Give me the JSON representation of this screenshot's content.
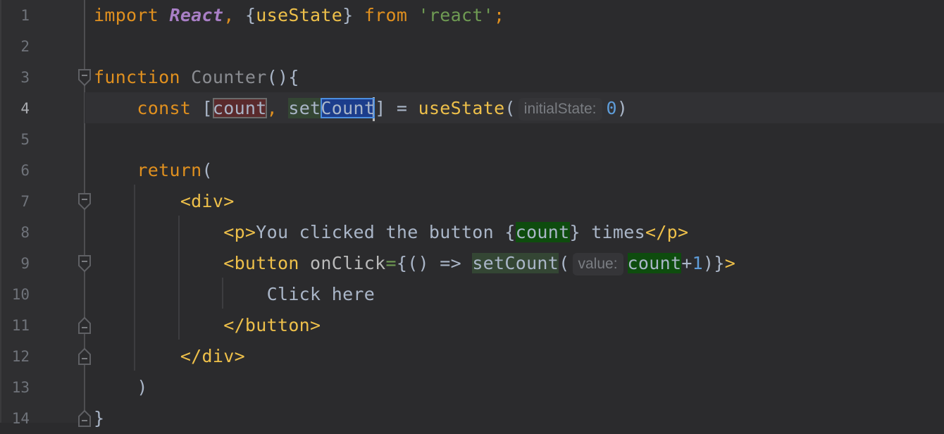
{
  "editor": {
    "language": "javascript-react",
    "current_line": 4,
    "line_numbers": [
      "1",
      "2",
      "3",
      "4",
      "5",
      "6",
      "7",
      "8",
      "9",
      "10",
      "11",
      "12",
      "13",
      "14"
    ],
    "lines": {
      "l1": {
        "kw_import": "import",
        "react": "React",
        "comma": ",",
        "brace_open": " {",
        "useState": "useState",
        "brace_close": "}",
        "kw_from": " from ",
        "module": "'react'",
        "semi": ";"
      },
      "l3": {
        "kw_function": "function",
        "name": " Counter",
        "rest": "(){"
      },
      "l4": {
        "indent": "    ",
        "kw_const": "const",
        "bracket_open": " [",
        "count": "count",
        "comma": ",",
        "space": " ",
        "set": "set",
        "Count": "Count",
        "bracket_close": "]",
        "assign": " = ",
        "useState": "useState",
        "paren_open": "(",
        "hint": "initialState:",
        "zero": "0",
        "paren_close": ")"
      },
      "l6": {
        "indent": "    ",
        "kw_return": "return",
        "paren": "("
      },
      "l7": {
        "indent": "        ",
        "tag": "<div>"
      },
      "l8": {
        "indent": "            ",
        "tag_open": "<p>",
        "text": "You clicked the button ",
        "brace_open": "{",
        "count": "count",
        "brace_close": "}",
        "text2": " times",
        "tag_close": "</p>"
      },
      "l9": {
        "indent": "            ",
        "tag_open": "<button",
        "attr": " onClick",
        "eq": "=",
        "arrow": "{() => ",
        "setCount": "setCount",
        "paren_open": "(",
        "hint": "value:",
        "count": "count",
        "plus": "+",
        "one": "1",
        "tail": ")}",
        "gt": ">"
      },
      "l10": {
        "indent": "                ",
        "text": "Click here"
      },
      "l11": {
        "indent": "            ",
        "tag": "</button>"
      },
      "l12": {
        "indent": "        ",
        "tag": "</div>"
      },
      "l13": {
        "indent": "    ",
        "paren": ")"
      },
      "l14": {
        "brace": "}"
      }
    }
  }
}
